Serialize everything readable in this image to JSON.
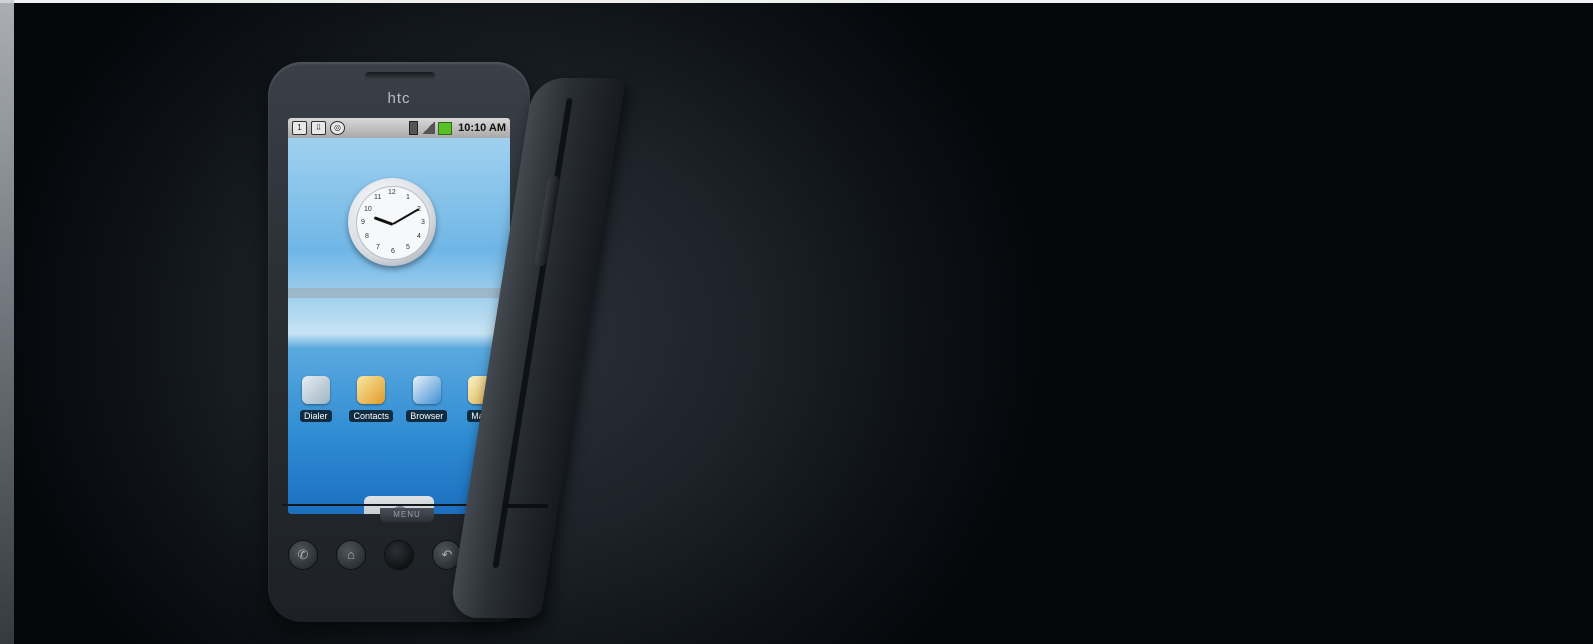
{
  "device": {
    "brand": "htc",
    "menu_label": "MENU"
  },
  "statusbar": {
    "time": "10:10 AM",
    "notif_icons": [
      "calendar-icon",
      "usb-icon",
      "sync-icon"
    ]
  },
  "clock": {
    "numbers": [
      "12",
      "1",
      "2",
      "3",
      "4",
      "5",
      "6",
      "7",
      "8",
      "9",
      "10",
      "11"
    ]
  },
  "apps": [
    {
      "label": "Dialer",
      "icon": "dialer-icon"
    },
    {
      "label": "Contacts",
      "icon": "contacts-icon"
    },
    {
      "label": "Browser",
      "icon": "browser-icon"
    },
    {
      "label": "Maps",
      "icon": "maps-icon"
    }
  ],
  "nav": [
    {
      "icon": "call-icon",
      "glyph": "✆"
    },
    {
      "icon": "home-icon",
      "glyph": "⌂"
    },
    {
      "icon": "trackball-icon",
      "glyph": ""
    },
    {
      "icon": "back-icon",
      "glyph": "↶"
    },
    {
      "icon": "end-call-icon",
      "glyph": "☎"
    }
  ],
  "colors": {
    "background": "#05070b",
    "statusbar": "#b5b5b5",
    "wallpaper_sky": "#8fc9ee",
    "wallpaper_sea": "#2e8bd3"
  }
}
